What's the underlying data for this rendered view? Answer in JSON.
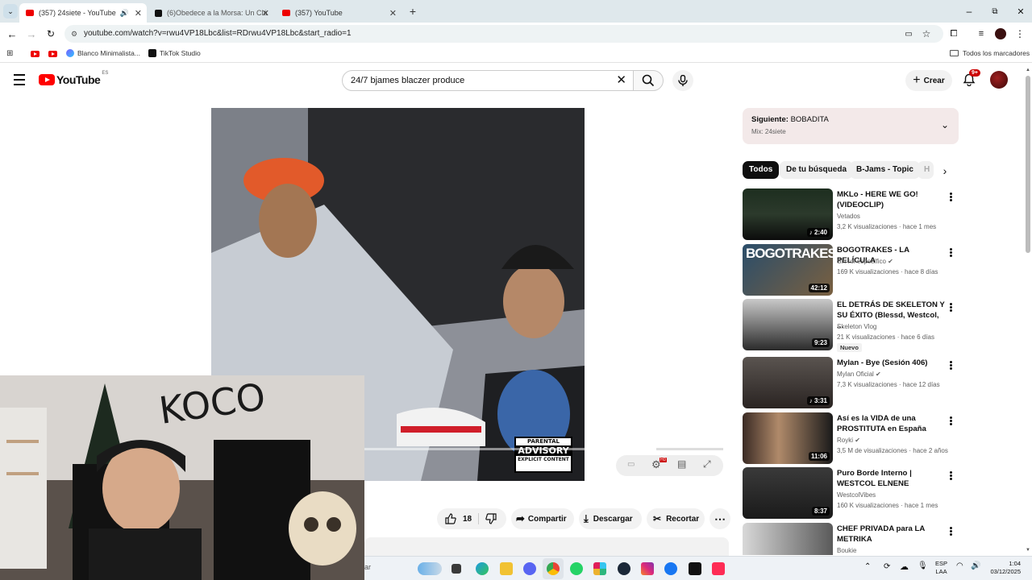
{
  "browser": {
    "tabs": [
      {
        "label": "(357) 24siete - YouTube",
        "active": true
      },
      {
        "label": "(6)Obedece a la Morsa: Un Clá",
        "active": false
      },
      {
        "label": "(357) YouTube",
        "active": false
      }
    ],
    "url": "youtube.com/watch?v=rwu4VP18Lbc&list=RDrwu4VP18Lbc&start_radio=1",
    "bookmarks": [
      {
        "label": ""
      },
      {
        "label": ""
      },
      {
        "label": "Blanco Minimalista..."
      },
      {
        "label": "TikTok Studio"
      }
    ],
    "all_bookmarks": "Todos los marcadores"
  },
  "youtube": {
    "logo_text": "YouTube",
    "region": "ES",
    "search_value": "24/7 bjames blaczer produce",
    "create_label": "Crear",
    "notif_count": "9+"
  },
  "player": {
    "parental_line1": "PARENTAL",
    "parental_line2": "ADVISORY",
    "parental_line3": "EXPLICIT CONTENT"
  },
  "actions": {
    "likes": "18",
    "share": "Compartir",
    "download": "Descargar",
    "clip": "Recortar"
  },
  "sidebar": {
    "next_label": "Siguiente:",
    "next_title": "BOBADITA",
    "next_sub": "Mix: 24siete",
    "chips": [
      "Todos",
      "De tu búsqueda",
      "B-Jams - Topic",
      "H"
    ],
    "items": [
      {
        "title": "MKLo - HERE WE GO! (VIDEOCLIP)",
        "channel": "Vetados",
        "meta": "3,2 K visualizaciones · hace 1 mes",
        "duration": "2:40",
        "verified": false,
        "new": false
      },
      {
        "title": "BOGOTRAKES - LA PELÍCULA",
        "channel": "Sin rol específico",
        "meta": "169 K visualizaciones · hace 8 días",
        "duration": "42:12",
        "verified": true,
        "new": false
      },
      {
        "title": "EL DETRÁS DE SKELETON Y SU ÉXITO (Blessd, Westcol, ...",
        "channel": "Skeleton Vlog",
        "meta": "21 K visualizaciones · hace 6 días",
        "duration": "9:23",
        "verified": false,
        "new": true,
        "new_label": "Nuevo"
      },
      {
        "title": "Mylan - Bye (Sesión 406)",
        "channel": "Mylan Oficial",
        "meta": "7,3 K visualizaciones · hace 12 días",
        "duration": "3:31",
        "verified": true,
        "new": false
      },
      {
        "title": "Así es la VIDA de una PROSTITUTA en España",
        "channel": "Royki",
        "meta": "3,5 M de visualizaciones · hace 2 años",
        "duration": "11:06",
        "verified": true,
        "new": false
      },
      {
        "title": "Puro Borde Interno | WESTCOL ELNENE",
        "channel": "WestcolVibes",
        "meta": "160 K visualizaciones · hace 1 mes",
        "duration": "8:37",
        "verified": false,
        "new": false
      },
      {
        "title": "CHEF PRIVADA para LA METRIKA",
        "channel": "Boukie",
        "meta": "",
        "duration": "",
        "verified": false,
        "new": false
      }
    ]
  },
  "taskbar": {
    "search_tail": "ar",
    "lang1": "ESP",
    "lang2": "LAA",
    "time": "1:04",
    "date": "03/12/2025"
  },
  "colors": {
    "youtube_red": "#ff0000",
    "chip_active": "#0f0f0f",
    "next_bg": "#f3e9e9"
  }
}
